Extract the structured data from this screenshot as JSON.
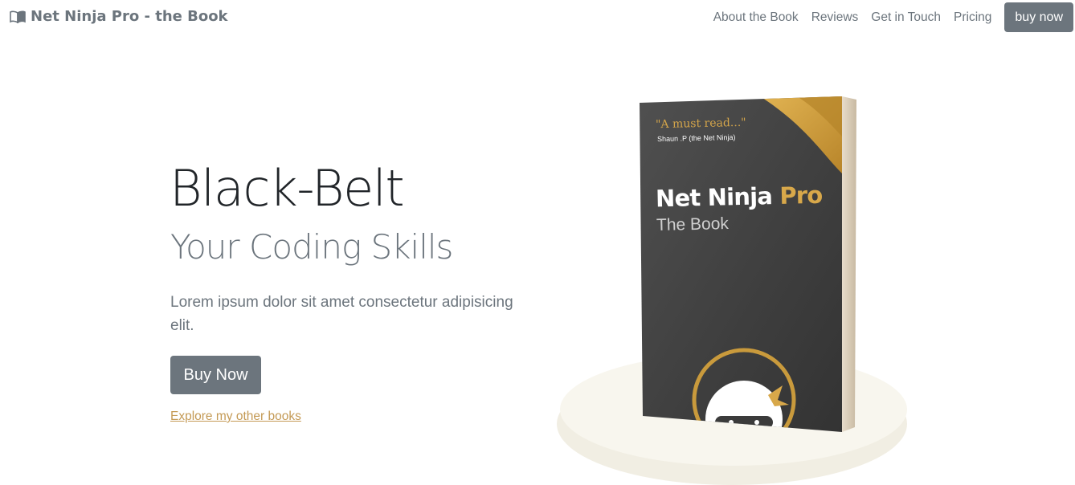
{
  "nav": {
    "brand": "Net Ninja Pro - the Book",
    "links": [
      "About the Book",
      "Reviews",
      "Get in Touch",
      "Pricing"
    ],
    "cta": "buy now"
  },
  "hero": {
    "title": "Black-Belt",
    "subtitle": "Your Coding Skills",
    "text": "Lorem ipsum dolor sit amet consectetur adipisicing elit.",
    "button": "Buy Now",
    "link": "Explore my other books"
  },
  "book": {
    "quote": "\"A must read...\"",
    "quote_author": "Shaun .P (the Net Ninja)",
    "title_main": "Net Ninja",
    "title_accent": "Pro",
    "subtitle": "The Book"
  },
  "colors": {
    "accent": "#c49a55",
    "secondary": "#6c757d",
    "book_cover": "#404040",
    "gold": "#d8a84a"
  }
}
